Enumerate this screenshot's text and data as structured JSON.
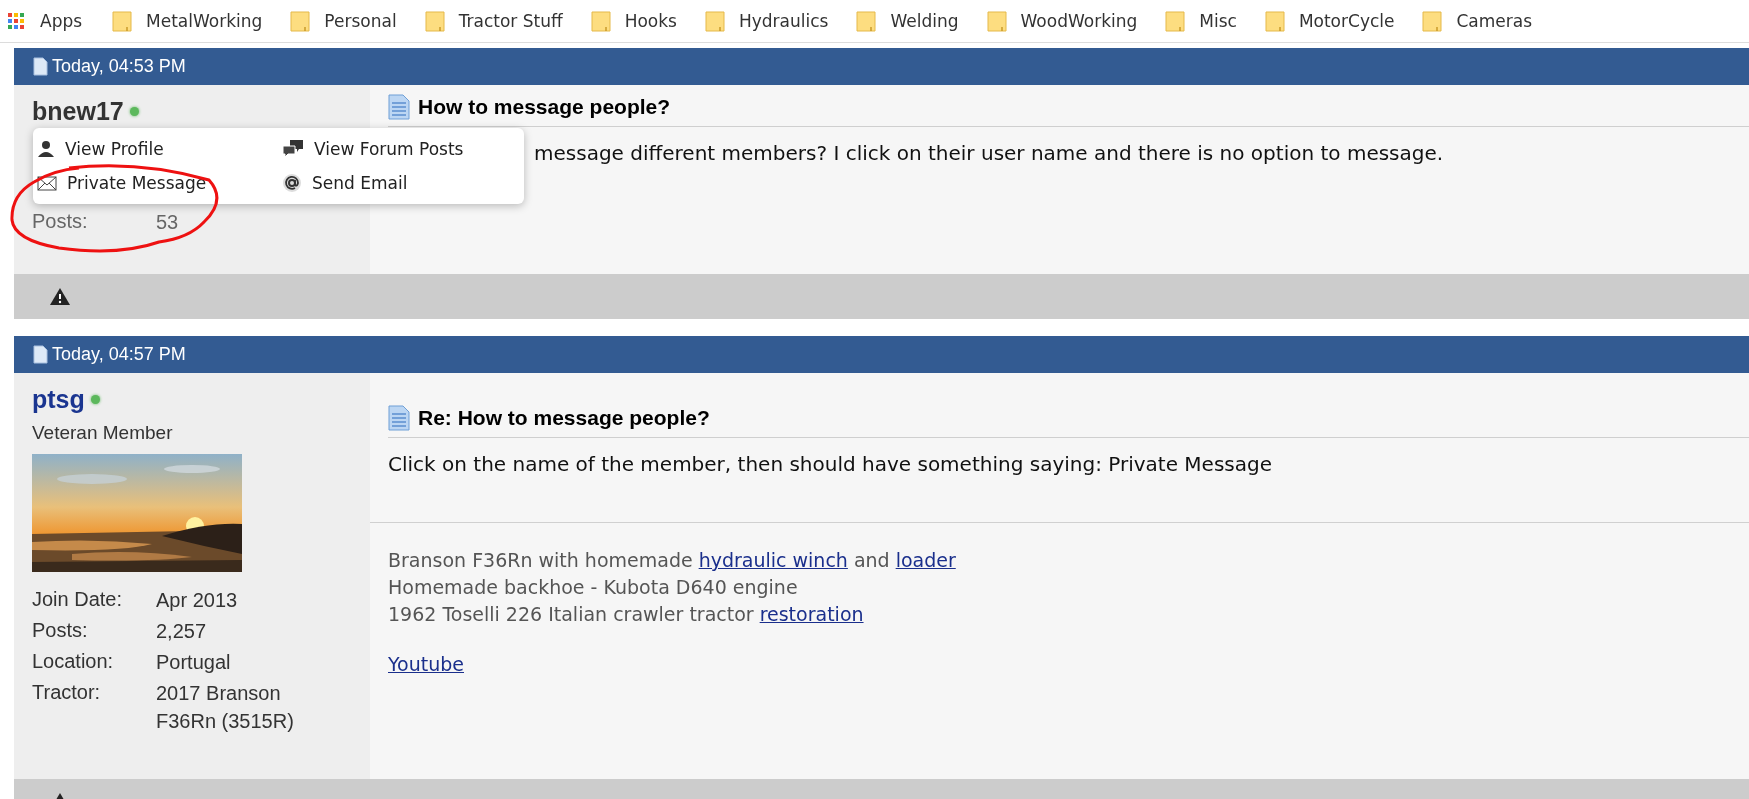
{
  "bookmarks_bar": {
    "apps": "Apps",
    "folders": [
      "MetalWorking",
      "Personal",
      "Tractor Stuff",
      "Hooks",
      "Hydraulics",
      "Welding",
      "WoodWorking",
      "Misc",
      "MotorCycle",
      "Cameras"
    ]
  },
  "posts": [
    {
      "timestamp": "Today, 04:53 PM",
      "user": {
        "name": "bnew17",
        "online": true
      },
      "details": [
        {
          "label": "Posts:",
          "value": "53"
        }
      ],
      "title": "How to message people?",
      "body": "message different members? I click on their user name and there is no option to message.",
      "user_menu": {
        "items": [
          "View Profile",
          "View Forum Posts",
          "Private Message",
          "Send Email"
        ]
      }
    },
    {
      "timestamp": "Today, 04:57 PM",
      "user": {
        "name": "ptsg",
        "online": true,
        "rank": "Veteran Member"
      },
      "details": [
        {
          "label": "Join Date:",
          "value": "Apr 2013"
        },
        {
          "label": "Posts:",
          "value": "2,257"
        },
        {
          "label": "Location:",
          "value": "Portugal"
        },
        {
          "label": "Tractor:",
          "value": "2017 Branson F36Rn (3515R)"
        }
      ],
      "title": "Re: How to message people?",
      "body": "Click on the name of the member, then should have something saying: Private Message",
      "signature": [
        [
          [
            {
              "text": "Branson F36Rn with homemade",
              "link": false
            },
            {
              "text": "hydraulic winch",
              "link": true
            },
            {
              "text": "and",
              "link": false
            },
            {
              "text": "loader",
              "link": true
            }
          ],
          [
            {
              "text": "Homemade backhoe - Kubota D640 engine",
              "link": false
            }
          ],
          [
            {
              "text": "1962 Toselli 226 Italian crawler tractor",
              "link": false
            },
            {
              "text": "restoration",
              "link": true
            }
          ]
        ],
        [
          [
            {
              "text": "Youtube",
              "link": true
            }
          ]
        ]
      ]
    }
  ]
}
